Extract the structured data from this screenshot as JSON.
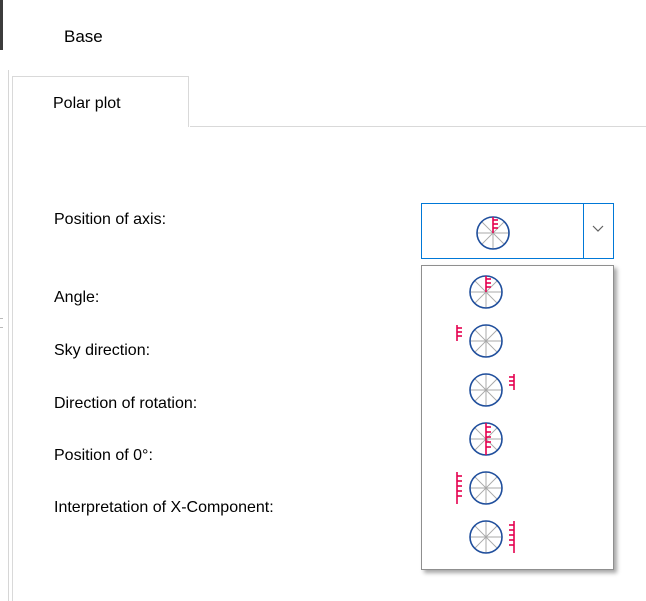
{
  "window": {
    "title": "Base"
  },
  "tabs": [
    {
      "label": "Polar plot",
      "selected": true
    }
  ],
  "form": {
    "labels": [
      "Position of axis:",
      "Angle:",
      "Sky direction:",
      "Direction of rotation:",
      "Position of 0°:",
      "Interpretation of X-Component:"
    ]
  },
  "position_of_axis": {
    "selected_icon": "axis-center-right-icon",
    "options": [
      "axis-center-right-icon",
      "axis-outside-left-icon",
      "axis-outside-right-icon",
      "axis-center-left-icon",
      "axis-edge-left-icon",
      "axis-edge-right-icon"
    ]
  },
  "colors": {
    "accent": "#0078d7",
    "circle": "#1f4e9c",
    "spokes": "#a8a8a8",
    "axis": "#e4004f"
  }
}
